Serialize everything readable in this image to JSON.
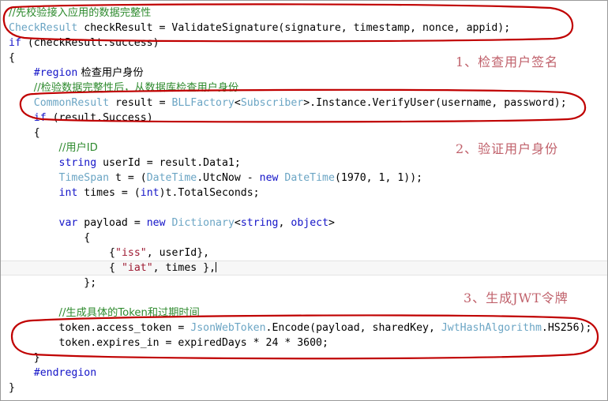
{
  "editor": {
    "language": "csharp",
    "background": "#ffffff",
    "border_color": "#9a9a9a",
    "colors": {
      "comment": "#2f8b2f",
      "keyword": "#1414c8",
      "type": "#6ba5c4",
      "string": "#9e1b33",
      "plain": "#000000",
      "annotation": "#c0616b",
      "ellipse": "#c00000",
      "current_line_highlight": "#f7f7f7"
    },
    "lines": [
      {
        "id": "l1",
        "indent": 0,
        "highlight": false,
        "tokens": [
          {
            "t": "comment",
            "v": "//先校验接入应用的数据完整性"
          }
        ]
      },
      {
        "id": "l2",
        "indent": 0,
        "highlight": false,
        "tokens": [
          {
            "t": "type",
            "v": "CheckResult"
          },
          {
            "t": "plain",
            "v": " checkResult = ValidateSignature(signature, timestamp, nonce, appid);"
          }
        ]
      },
      {
        "id": "l3",
        "indent": 0,
        "highlight": false,
        "tokens": [
          {
            "t": "keyword",
            "v": "if"
          },
          {
            "t": "plain",
            "v": " (checkResult.success)"
          }
        ]
      },
      {
        "id": "l4",
        "indent": 0,
        "highlight": false,
        "tokens": [
          {
            "t": "plain",
            "v": "{"
          }
        ]
      },
      {
        "id": "l5",
        "indent": 1,
        "highlight": false,
        "tokens": [
          {
            "t": "keyword",
            "v": "#region"
          },
          {
            "t": "plain",
            "v": " 检查用户身份"
          }
        ]
      },
      {
        "id": "l6",
        "indent": 1,
        "highlight": false,
        "tokens": [
          {
            "t": "comment",
            "v": "//检验数据完整性后，从数据库检查用户身份"
          }
        ]
      },
      {
        "id": "l7",
        "indent": 1,
        "highlight": false,
        "tokens": [
          {
            "t": "type",
            "v": "CommonResult"
          },
          {
            "t": "plain",
            "v": " result = "
          },
          {
            "t": "type",
            "v": "BLLFactory"
          },
          {
            "t": "plain",
            "v": "<"
          },
          {
            "t": "type",
            "v": "Subscriber"
          },
          {
            "t": "plain",
            "v": ">.Instance.VerifyUser(username, password);"
          }
        ]
      },
      {
        "id": "l8",
        "indent": 1,
        "highlight": false,
        "tokens": [
          {
            "t": "keyword",
            "v": "if"
          },
          {
            "t": "plain",
            "v": " (result.Success)"
          }
        ]
      },
      {
        "id": "l9",
        "indent": 1,
        "highlight": false,
        "tokens": [
          {
            "t": "plain",
            "v": "{"
          }
        ]
      },
      {
        "id": "l10",
        "indent": 2,
        "highlight": false,
        "tokens": [
          {
            "t": "comment",
            "v": "//用户ID"
          }
        ]
      },
      {
        "id": "l11",
        "indent": 2,
        "highlight": false,
        "tokens": [
          {
            "t": "keyword",
            "v": "string"
          },
          {
            "t": "plain",
            "v": " userId = result.Data1;"
          }
        ]
      },
      {
        "id": "l12",
        "indent": 2,
        "highlight": false,
        "tokens": [
          {
            "t": "type",
            "v": "TimeSpan"
          },
          {
            "t": "plain",
            "v": " t = ("
          },
          {
            "t": "type",
            "v": "DateTime"
          },
          {
            "t": "plain",
            "v": ".UtcNow - "
          },
          {
            "t": "keyword",
            "v": "new"
          },
          {
            "t": "plain",
            "v": " "
          },
          {
            "t": "type",
            "v": "DateTime"
          },
          {
            "t": "plain",
            "v": "(1970, 1, 1));"
          }
        ]
      },
      {
        "id": "l13",
        "indent": 2,
        "highlight": false,
        "tokens": [
          {
            "t": "keyword",
            "v": "int"
          },
          {
            "t": "plain",
            "v": " times = ("
          },
          {
            "t": "keyword",
            "v": "int"
          },
          {
            "t": "plain",
            "v": ")t.TotalSeconds;"
          }
        ]
      },
      {
        "id": "l14",
        "indent": 0,
        "highlight": false,
        "tokens": [
          {
            "t": "plain",
            "v": ""
          }
        ]
      },
      {
        "id": "l15",
        "indent": 2,
        "highlight": false,
        "tokens": [
          {
            "t": "keyword",
            "v": "var"
          },
          {
            "t": "plain",
            "v": " payload = "
          },
          {
            "t": "keyword",
            "v": "new"
          },
          {
            "t": "plain",
            "v": " "
          },
          {
            "t": "type",
            "v": "Dictionary"
          },
          {
            "t": "plain",
            "v": "<"
          },
          {
            "t": "keyword",
            "v": "string"
          },
          {
            "t": "plain",
            "v": ", "
          },
          {
            "t": "keyword",
            "v": "object"
          },
          {
            "t": "plain",
            "v": ">"
          }
        ]
      },
      {
        "id": "l16",
        "indent": 3,
        "highlight": false,
        "tokens": [
          {
            "t": "plain",
            "v": "{"
          }
        ]
      },
      {
        "id": "l17",
        "indent": 4,
        "highlight": false,
        "tokens": [
          {
            "t": "plain",
            "v": "{"
          },
          {
            "t": "string",
            "v": "\"iss\""
          },
          {
            "t": "plain",
            "v": ", userId},"
          }
        ]
      },
      {
        "id": "l18",
        "indent": 4,
        "highlight": true,
        "tokens": [
          {
            "t": "plain",
            "v": "{ "
          },
          {
            "t": "string",
            "v": "\"iat\""
          },
          {
            "t": "plain",
            "v": ", times },"
          },
          {
            "t": "caret",
            "v": ""
          }
        ]
      },
      {
        "id": "l19",
        "indent": 3,
        "highlight": false,
        "tokens": [
          {
            "t": "plain",
            "v": "};"
          }
        ]
      },
      {
        "id": "l20",
        "indent": 0,
        "highlight": false,
        "tokens": [
          {
            "t": "plain",
            "v": ""
          }
        ]
      },
      {
        "id": "l21",
        "indent": 2,
        "highlight": false,
        "tokens": [
          {
            "t": "comment",
            "v": "//生成具体的Token和过期时间"
          }
        ]
      },
      {
        "id": "l22",
        "indent": 2,
        "highlight": false,
        "tokens": [
          {
            "t": "plain",
            "v": "token.access_token = "
          },
          {
            "t": "type",
            "v": "JsonWebToken"
          },
          {
            "t": "plain",
            "v": ".Encode(payload, sharedKey, "
          },
          {
            "t": "type",
            "v": "JwtHashAlgorithm"
          },
          {
            "t": "plain",
            "v": ".HS256);"
          }
        ]
      },
      {
        "id": "l23",
        "indent": 2,
        "highlight": false,
        "tokens": [
          {
            "t": "plain",
            "v": "token.expires_in = expiredDays * 24 * 3600;"
          }
        ]
      },
      {
        "id": "l24",
        "indent": 1,
        "highlight": false,
        "tokens": [
          {
            "t": "plain",
            "v": "}"
          }
        ]
      },
      {
        "id": "l25",
        "indent": 1,
        "highlight": false,
        "tokens": [
          {
            "t": "keyword",
            "v": "#endregion"
          }
        ]
      },
      {
        "id": "l26",
        "indent": 0,
        "highlight": false,
        "tokens": [
          {
            "t": "plain",
            "v": "}"
          }
        ]
      }
    ]
  },
  "annotations": {
    "notes": [
      {
        "id": "note-1",
        "label": "1、检查用户签名"
      },
      {
        "id": "note-2",
        "label": "2、验证用户身份"
      },
      {
        "id": "note-3",
        "label": "3、生成JWT令牌"
      }
    ],
    "ellipses": [
      {
        "id": "ellipse-1",
        "target": "validate-signature-call"
      },
      {
        "id": "ellipse-2",
        "target": "verify-user-call"
      },
      {
        "id": "ellipse-3",
        "target": "jwt-token-generation"
      }
    ]
  }
}
